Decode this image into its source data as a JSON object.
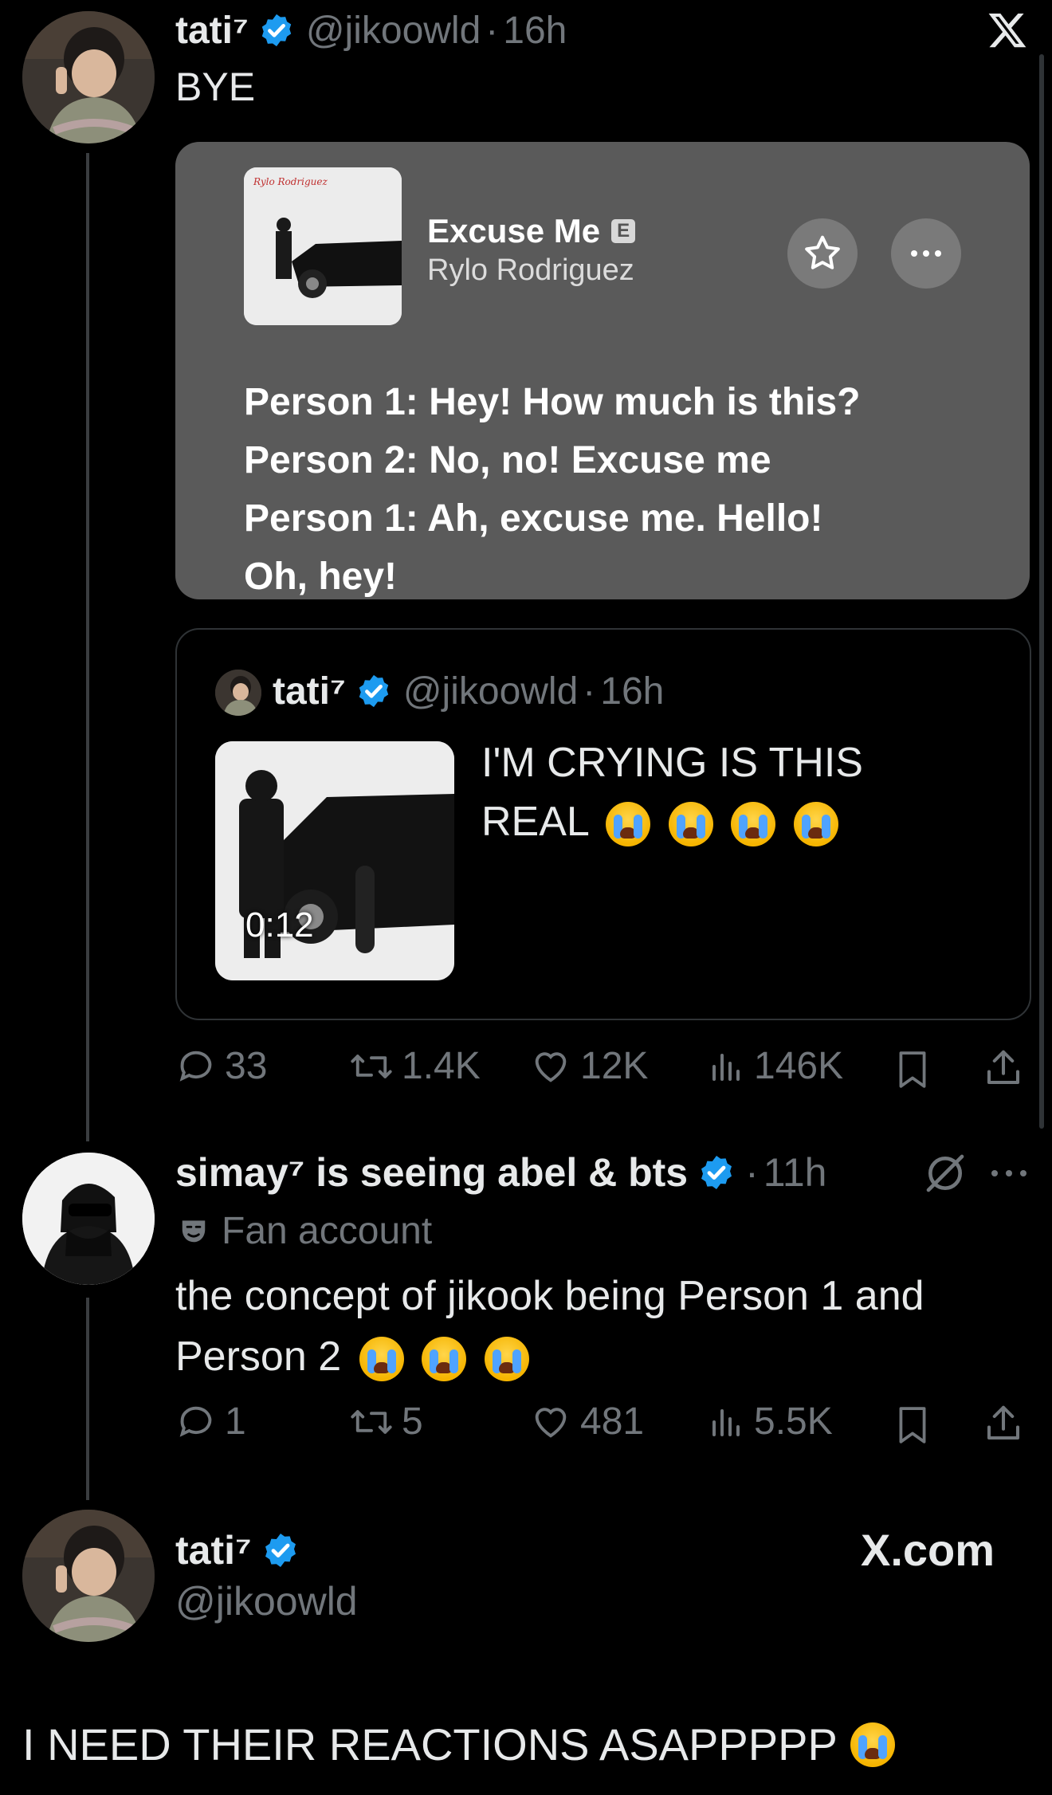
{
  "tweet1": {
    "display_name": "tati⁷",
    "handle": "@jikoowld",
    "separator": "·",
    "time": "16h",
    "text": "BYE",
    "music_card": {
      "song_title": "Excuse Me",
      "explicit_badge": "E",
      "artist": "Rylo Rodriguez",
      "lyrics": [
        "Person 1: Hey! How much is this?",
        "Person 2: No, no! Excuse me",
        "Person 1: Ah, excuse me. Hello!",
        "Oh, hey!"
      ]
    },
    "quoted": {
      "display_name": "tati⁷",
      "handle": "@jikoowld",
      "separator": "·",
      "time": "16h",
      "text_line1": "I'M CRYING IS THIS",
      "text_line2": "REAL",
      "video_duration": "0:12"
    },
    "actions": {
      "replies": "33",
      "reposts": "1.4K",
      "likes": "12K",
      "views": "146K"
    }
  },
  "tweet2": {
    "display_name": "simay⁷ is seeing abel & bts",
    "separator": "·",
    "time": "11h",
    "label": "Fan account",
    "text_line1": "the concept of jikook being Person 1 and",
    "text_line2": "Person 2",
    "actions": {
      "replies": "1",
      "reposts": "5",
      "likes": "481",
      "views": "5.5K"
    }
  },
  "footer": {
    "display_name": "tati⁷",
    "handle": "@jikoowld",
    "brand": "X.com",
    "caption": "I NEED THEIR REACTIONS ASAPPPPP"
  },
  "icons": {
    "x_logo": "x-logo-icon",
    "verified": "verified-badge-icon",
    "reply": "reply-icon",
    "repost": "repost-icon",
    "like": "heart-icon",
    "views": "views-icon",
    "bookmark": "bookmark-icon",
    "share": "share-icon",
    "grok": "grok-icon",
    "more": "more-icon",
    "star": "star-icon",
    "fan": "fan-mask-icon"
  },
  "colors": {
    "background": "#000000",
    "verified": "#1d9bf0",
    "muted": "#71767b",
    "card": "#5a5a5a"
  }
}
